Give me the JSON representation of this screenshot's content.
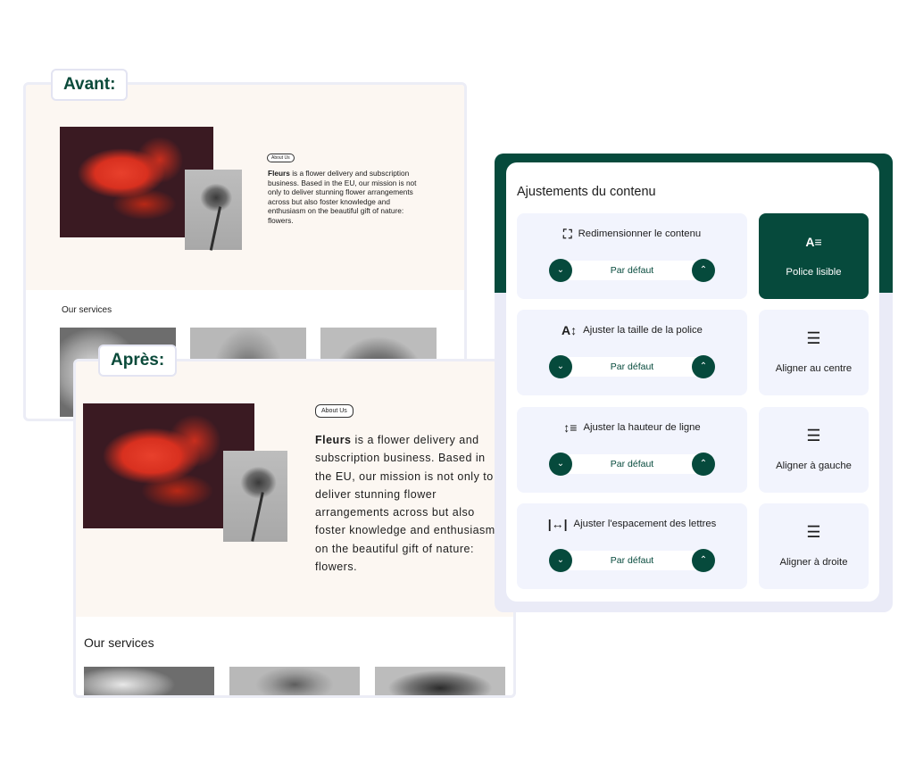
{
  "labels": {
    "before": "Avant:",
    "after": "Après:"
  },
  "site": {
    "about_badge": "About Us",
    "brand": "Fleurs",
    "intro_before": " is a flower delivery and subscription business. Based in the EU, our mission is not only to deliver stunning flower arrangements across but also foster knowledge and enthusiasm on the beautiful gift of nature: flowers.",
    "intro_after": " is a flower delivery and subscription business. Based in the EU, our mission is not only to deliver stunning flower arrangements across but also foster knowledge and enthusiasm on the beautiful gift of nature: flowers.",
    "services_title": "Our services"
  },
  "panel": {
    "title": "Ajustements du contenu",
    "stepper_value": "Par défaut",
    "controls": [
      {
        "label": "Redimensionner le contenu",
        "icon": "expand-icon"
      },
      {
        "label": "Ajuster la taille de la police",
        "icon": "font-size-icon"
      },
      {
        "label": "Ajuster la hauteur de ligne",
        "icon": "line-height-icon"
      },
      {
        "label": "Ajuster l'espacement des lettres",
        "icon": "letter-spacing-icon"
      }
    ],
    "toggles": [
      {
        "label": "Police lisible",
        "icon": "readable-font-icon",
        "active": true
      },
      {
        "label": "Aligner au centre",
        "icon": "align-center-icon",
        "active": false
      },
      {
        "label": "Aligner à gauche",
        "icon": "align-left-icon",
        "active": false
      },
      {
        "label": "Aligner à droite",
        "icon": "align-right-icon",
        "active": false
      }
    ]
  },
  "colors": {
    "brand_green": "#064a3c",
    "tile_bg": "#f2f4fd",
    "hero_bg": "#fcf7f2"
  }
}
